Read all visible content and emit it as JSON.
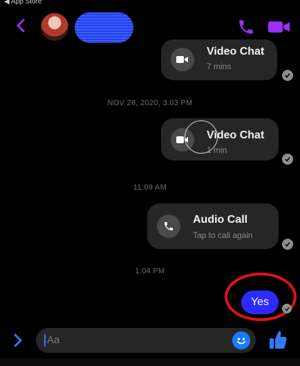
{
  "status": {
    "back_to_app": "◀ App Store"
  },
  "header": {
    "contact_name_redacted": true,
    "accent_color": "#8a2be2"
  },
  "messages": [
    {
      "type": "video",
      "title": "Video Chat",
      "subtitle": "7 mins"
    },
    {
      "type": "timestamp",
      "text": "NOV 26, 2020, 3:03 PM"
    },
    {
      "type": "video",
      "title": "Video Chat",
      "subtitle": "1 min"
    },
    {
      "type": "timestamp",
      "text": "11:09 AM"
    },
    {
      "type": "audio",
      "title": "Audio Call",
      "subtitle": "Tap to call again"
    },
    {
      "type": "timestamp",
      "text": "1:04 PM"
    },
    {
      "type": "text",
      "text": "Yes"
    }
  ],
  "composer": {
    "placeholder": "Aa"
  },
  "colors": {
    "accent": "#2b2bff",
    "icon_purple": "#9d2cff",
    "annotation_red": "#e01218"
  },
  "icons": [
    "back-chevron-icon",
    "phone-icon",
    "video-camera-icon",
    "video-call-icon",
    "audio-call-icon",
    "check-icon",
    "expand-chevron-icon",
    "emoji-icon",
    "thumbs-up-icon"
  ]
}
